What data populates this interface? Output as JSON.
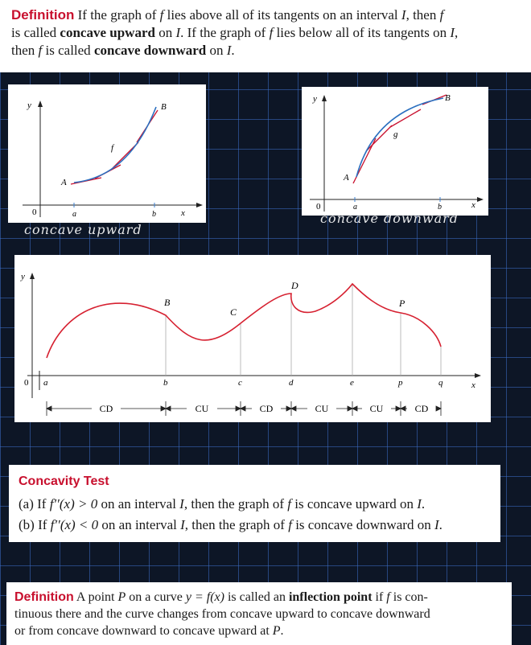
{
  "definition_concave": {
    "label": "Definition",
    "s1": "If the graph of",
    "f1": "f",
    "s2": "lies above all of its tangents on an interval",
    "i1": "I",
    "s3": ", then",
    "f2": "f",
    "s4": "is called",
    "term_up": "concave upward",
    "s5": "on",
    "i2": "I",
    "s6": ". If the graph of",
    "f3": "f",
    "s7": "lies below all of its tangents on",
    "i3": "I",
    "s8": ",",
    "s9": "then",
    "f4": "f",
    "s10": "is called",
    "term_down": "concave downward",
    "s11": "on",
    "i4": "I",
    "s12": "."
  },
  "graph_up": {
    "y": "y",
    "x": "x",
    "origin": "0",
    "a": "a",
    "b": "b",
    "A": "A",
    "B": "B",
    "f": "f",
    "handwritten": "concave upward"
  },
  "graph_down": {
    "y": "y",
    "x": "x",
    "origin": "0",
    "a": "a",
    "b": "b",
    "A": "A",
    "B": "B",
    "g": "g",
    "handwritten": "concave downward"
  },
  "graph_main": {
    "y": "y",
    "x": "x",
    "origin": "0",
    "points": [
      "B",
      "C",
      "D",
      "P"
    ],
    "ticks": [
      "a",
      "b",
      "c",
      "d",
      "e",
      "p",
      "q"
    ],
    "intervals": [
      "CD",
      "CU",
      "CD",
      "CU",
      "CU",
      "CD"
    ]
  },
  "concavity_test": {
    "title": "Concavity Test",
    "a_label": "(a)",
    "a_if": "If",
    "a_expr": "f′′(x) > 0",
    "a_rest1": "on an interval",
    "a_I": "I",
    "a_rest2": ", then the graph of",
    "a_f": "f",
    "a_rest3": "is concave upward on",
    "a_I2": "I",
    "a_end": ".",
    "b_label": "(b)",
    "b_if": "If",
    "b_expr": "f′′(x) < 0",
    "b_rest1": "on an interval",
    "b_I": "I",
    "b_rest2": ", then the graph of",
    "b_f": "f",
    "b_rest3": "is concave downward on",
    "b_I2": "I",
    "b_end": "."
  },
  "definition_inflection": {
    "label": "Definition",
    "s1": "A point",
    "P1": "P",
    "s2": "on a curve",
    "eq": "y = f(x)",
    "s3": "is called an",
    "term": "inflection point",
    "s4": "if",
    "f1": "f",
    "s5": "is con-",
    "s6": "tinuous there and the curve changes from concave upward to concave downward",
    "s7": "or from concave downward to concave upward at",
    "P2": "P",
    "s8": "."
  }
}
